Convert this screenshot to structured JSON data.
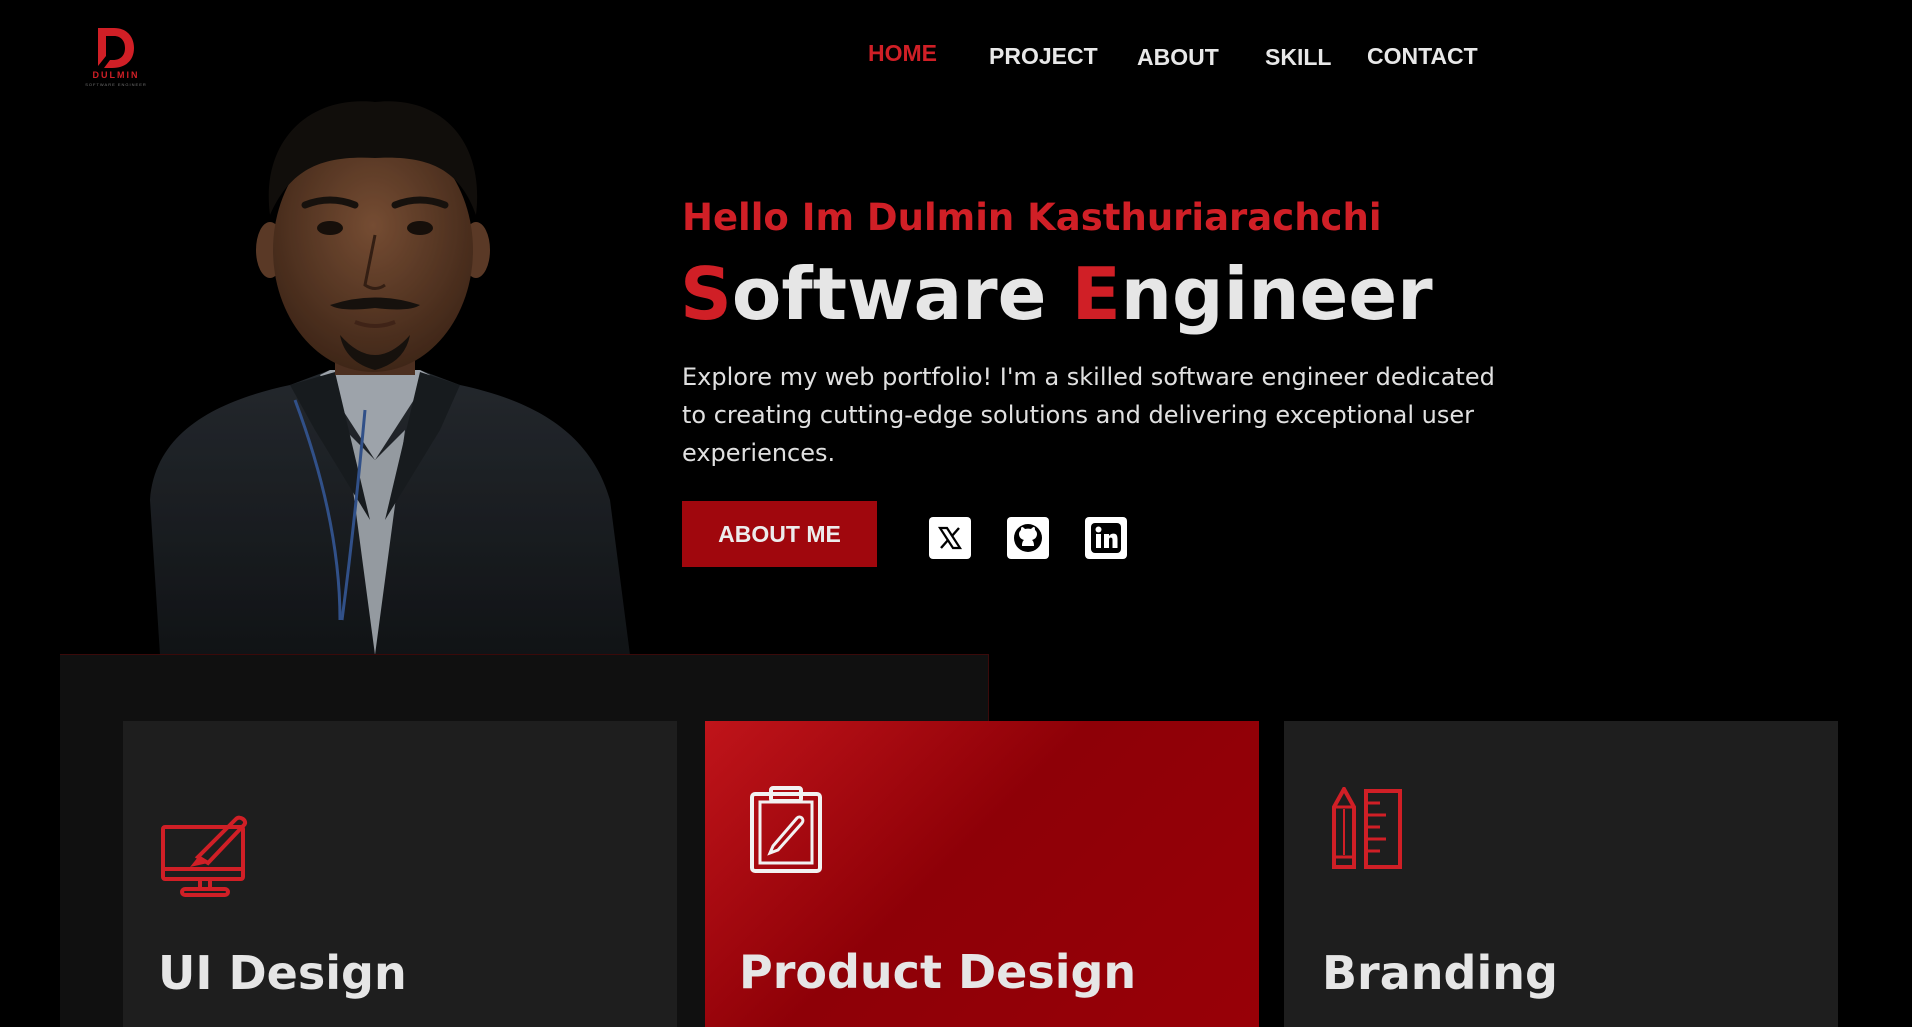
{
  "brand": {
    "logo_letter": "D",
    "logo_name": "DULMIN",
    "logo_tagline": "SOFTWARE ENGINEER",
    "accent_color": "#d01f26"
  },
  "nav": {
    "items": [
      {
        "label": "HOME",
        "active": true
      },
      {
        "label": "PROJECT",
        "active": false
      },
      {
        "label": "ABOUT",
        "active": false
      },
      {
        "label": "SKILL",
        "active": false
      },
      {
        "label": "CONTACT",
        "active": false
      }
    ]
  },
  "hero": {
    "greeting": "Hello Im Dulmin Kasthuriarachchi",
    "title_word1_first": "S",
    "title_word1_rest": "oftware ",
    "title_word2_first": "E",
    "title_word2_rest": "ngineer",
    "description": "Explore my web portfolio! I'm a skilled software engineer dedicated to creating cutting-edge solutions and delivering exceptional user experiences.",
    "about_button": "ABOUT ME",
    "social_icons": [
      "x-icon",
      "github-icon",
      "linkedin-icon"
    ]
  },
  "services": [
    {
      "title": "UI Design",
      "icon": "monitor-brush-icon",
      "highlighted": false
    },
    {
      "title": "Product Design",
      "icon": "clipboard-pencil-icon",
      "highlighted": true
    },
    {
      "title": "Branding",
      "icon": "pencil-ruler-icon",
      "highlighted": false
    }
  ]
}
